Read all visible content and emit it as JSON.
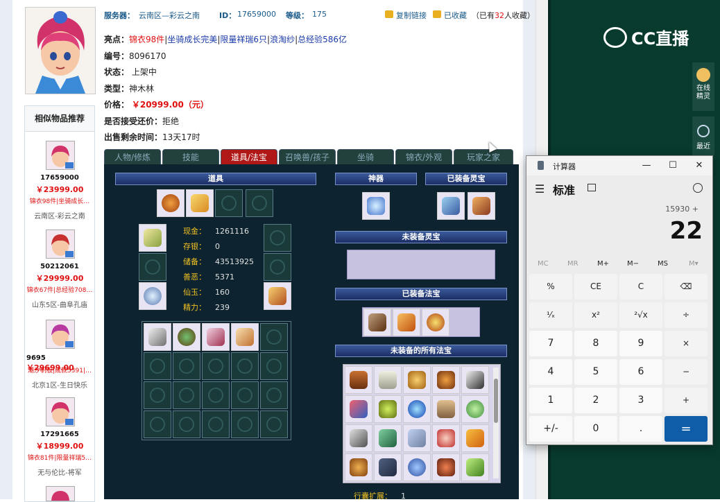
{
  "header": {
    "server_label": "服务器：",
    "server_value": "云南区—彩云之南",
    "id_label": "ID：",
    "id_value": "17659000",
    "level_label": "等级：",
    "level_value": "175",
    "copy_link": "复制链接",
    "collected": "已收藏",
    "collect_count_prefix": "（已有",
    "collect_count": "32",
    "collect_count_suffix": "人收藏）"
  },
  "info": {
    "highlight_label": "亮点：",
    "highlights": [
      "锦衣98件",
      "坐骑成长完美",
      "限量祥瑞6只",
      "浪淘纱",
      "总经验586亿"
    ],
    "number_label": "编号：",
    "number_value": "8096170",
    "status_label": "状态：",
    "status_value": "上架中",
    "type_label": "类型：",
    "type_value": "神木林",
    "price_label": "价格：",
    "price_value": "￥20999.00（元）",
    "bargain_label": "是否接受还价：",
    "bargain_value": "拒绝",
    "remaining_label": "出售剩余时间：",
    "remaining_value": "13天17时"
  },
  "recommend": {
    "title": "相似物品推荐",
    "items": [
      {
        "id": "17659000",
        "price": "￥23999.00",
        "tags": "锦衣98件|坐骑成长…",
        "server": "云南区-彩云之南"
      },
      {
        "id": "50212061",
        "price": "￥29999.00",
        "tags": "锦衣67件|总经验708…",
        "server": "山东5区-曲阜孔庙"
      },
      {
        "id": "9695",
        "price": "￥29699.00",
        "tags": "潮汐帆板|成就5391|…",
        "server": "北京1区-生日快乐"
      },
      {
        "id": "17291665",
        "price": "￥18999.00",
        "tags": "锦衣81件|限量祥瑞5…",
        "server": "无与伦比-将军"
      }
    ]
  },
  "tabs": [
    "人物/修炼",
    "技能",
    "道具/法宝",
    "召唤兽/孩子",
    "坐骑",
    "锦衣/外观",
    "玩家之家"
  ],
  "active_tab": 2,
  "panel": {
    "items_header": "道具",
    "shenqi_header": "神器",
    "equipped_spirit_header": "已装备灵宝",
    "unequipped_spirit_header": "未装备灵宝",
    "equipped_fabao_header": "已装备法宝",
    "unequipped_fabao_header": "未装备的所有法宝",
    "stats": [
      {
        "label": "现金：",
        "value": "1261116"
      },
      {
        "label": "存银：",
        "value": "0"
      },
      {
        "label": "储备：",
        "value": "43513925"
      },
      {
        "label": "善恶：",
        "value": "5371"
      },
      {
        "label": "仙玉：",
        "value": "160"
      },
      {
        "label": "精力：",
        "value": "239"
      }
    ],
    "bag_expand_label": "行囊扩展：",
    "bag_expand_value": "1"
  },
  "brand": {
    "logo": "CC直播",
    "online_label": "在线精灵",
    "recent_label": "最近"
  },
  "calculator": {
    "title": "计算器",
    "mode": "标准",
    "expression": "15930 +",
    "display": "22",
    "memory": [
      "MC",
      "MR",
      "M+",
      "M−",
      "MS",
      "M▾"
    ],
    "keys": [
      [
        "%",
        "CE",
        "C",
        "⌫"
      ],
      [
        "¹⁄ₓ",
        "x²",
        "²√x",
        "÷"
      ],
      [
        "7",
        "8",
        "9",
        "×"
      ],
      [
        "4",
        "5",
        "6",
        "−"
      ],
      [
        "1",
        "2",
        "3",
        "+"
      ],
      [
        "+/-",
        "0",
        ".",
        "="
      ]
    ]
  },
  "colors": {
    "accent_red": "#e01010",
    "calc_equals": "#0f5ca8",
    "panel_bg": "#0d2430"
  }
}
